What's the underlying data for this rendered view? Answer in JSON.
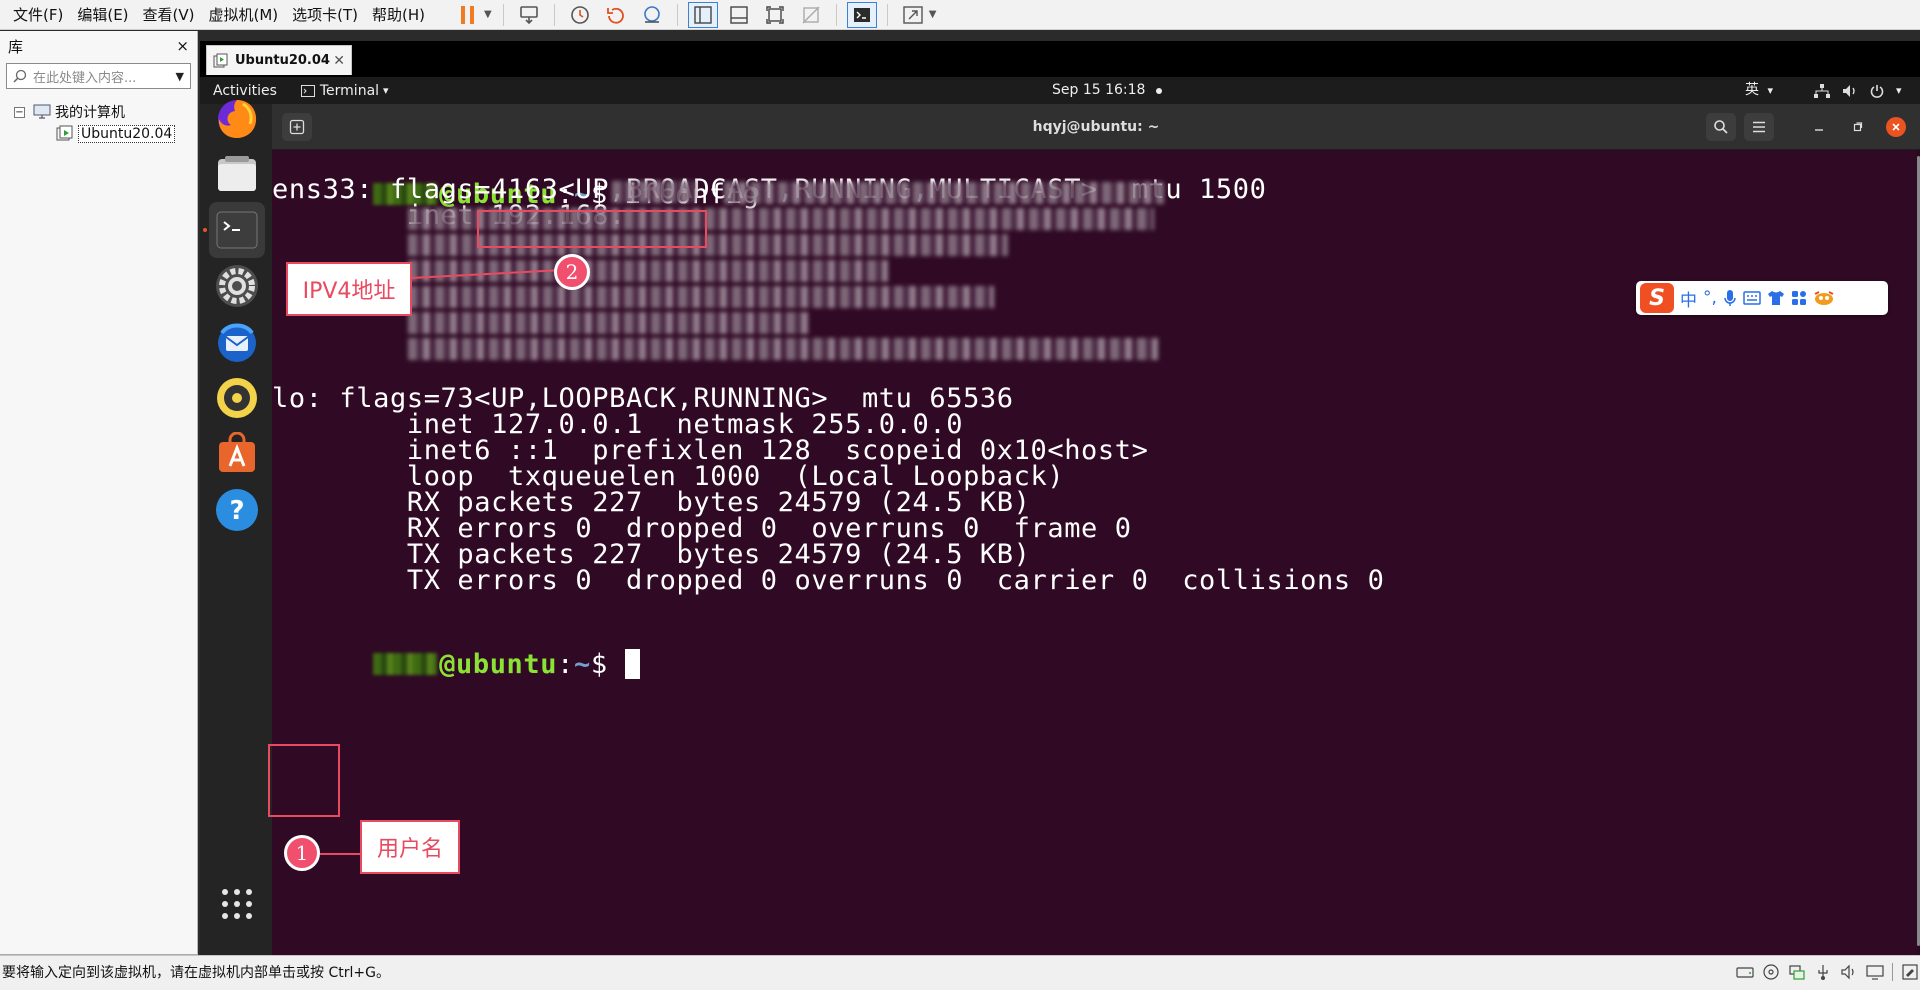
{
  "menubar": {
    "items": [
      "文件(F)",
      "编辑(E)",
      "查看(V)",
      "虚拟机(M)",
      "选项卡(T)",
      "帮助(H)"
    ]
  },
  "library": {
    "title": "库",
    "close": "×",
    "search_placeholder": "在此处键入内容...",
    "tree": {
      "root_toggle": "−",
      "root_label": "我的计算机",
      "vm_label": "Ubuntu20.04"
    }
  },
  "vm_tab": {
    "label": "Ubuntu20.04",
    "close": "✕"
  },
  "ubuntu_topbar": {
    "activities": "Activities",
    "app_menu": "Terminal",
    "app_menu_caret": "▾",
    "clock": "Sep 15  16:18",
    "input_method": "英",
    "input_method_caret": "▾"
  },
  "terminal": {
    "title": "hqyj@ubuntu: ~",
    "lines": {
      "prompt_host": "@ubuntu",
      "prompt_sep": ":",
      "prompt_path": "~",
      "prompt_dollar": "$ ",
      "command": "ifconfig",
      "ens33_flags": "ens33: flags=4163<UP,BROADCAST,RUNNING,MULTICAST>  mtu 1500",
      "ens33_inet": "        inet 192.168.",
      "lo_flags": "lo: flags=73<UP,LOOPBACK,RUNNING>  mtu 65536",
      "lo_inet": "        inet 127.0.0.1  netmask 255.0.0.0",
      "lo_inet6": "        inet6 ::1  prefixlen 128  scopeid 0x10<host>",
      "lo_loop": "        loop  txqueuelen 1000  (Local Loopback)",
      "lo_rx_packets": "        RX packets 227  bytes 24579 (24.5 KB)",
      "lo_rx_errors": "        RX errors 0  dropped 0  overruns 0  frame 0",
      "lo_tx_packets": "        TX packets 227  bytes 24579 (24.5 KB)",
      "lo_tx_errors": "        TX errors 0  dropped 0 overruns 0  carrier 0  collisions 0"
    }
  },
  "annotations": {
    "ipv4_label": "IPV4地址",
    "ipv4_badge": "2",
    "user_label": "用户名",
    "user_badge": "1"
  },
  "ime_toolbar": {
    "logo": "S",
    "mode": "中",
    "punct": "°,"
  },
  "statusbar": {
    "text": "要将输入定向到该虚拟机，请在虚拟机内部单击或按 Ctrl+G。"
  },
  "colors": {
    "terminal_bg": "#300a24",
    "prompt_green": "#8ae234",
    "prompt_blue": "#729fcf",
    "annotation_red": "#e84a5f",
    "ubuntu_orange": "#e95420"
  }
}
